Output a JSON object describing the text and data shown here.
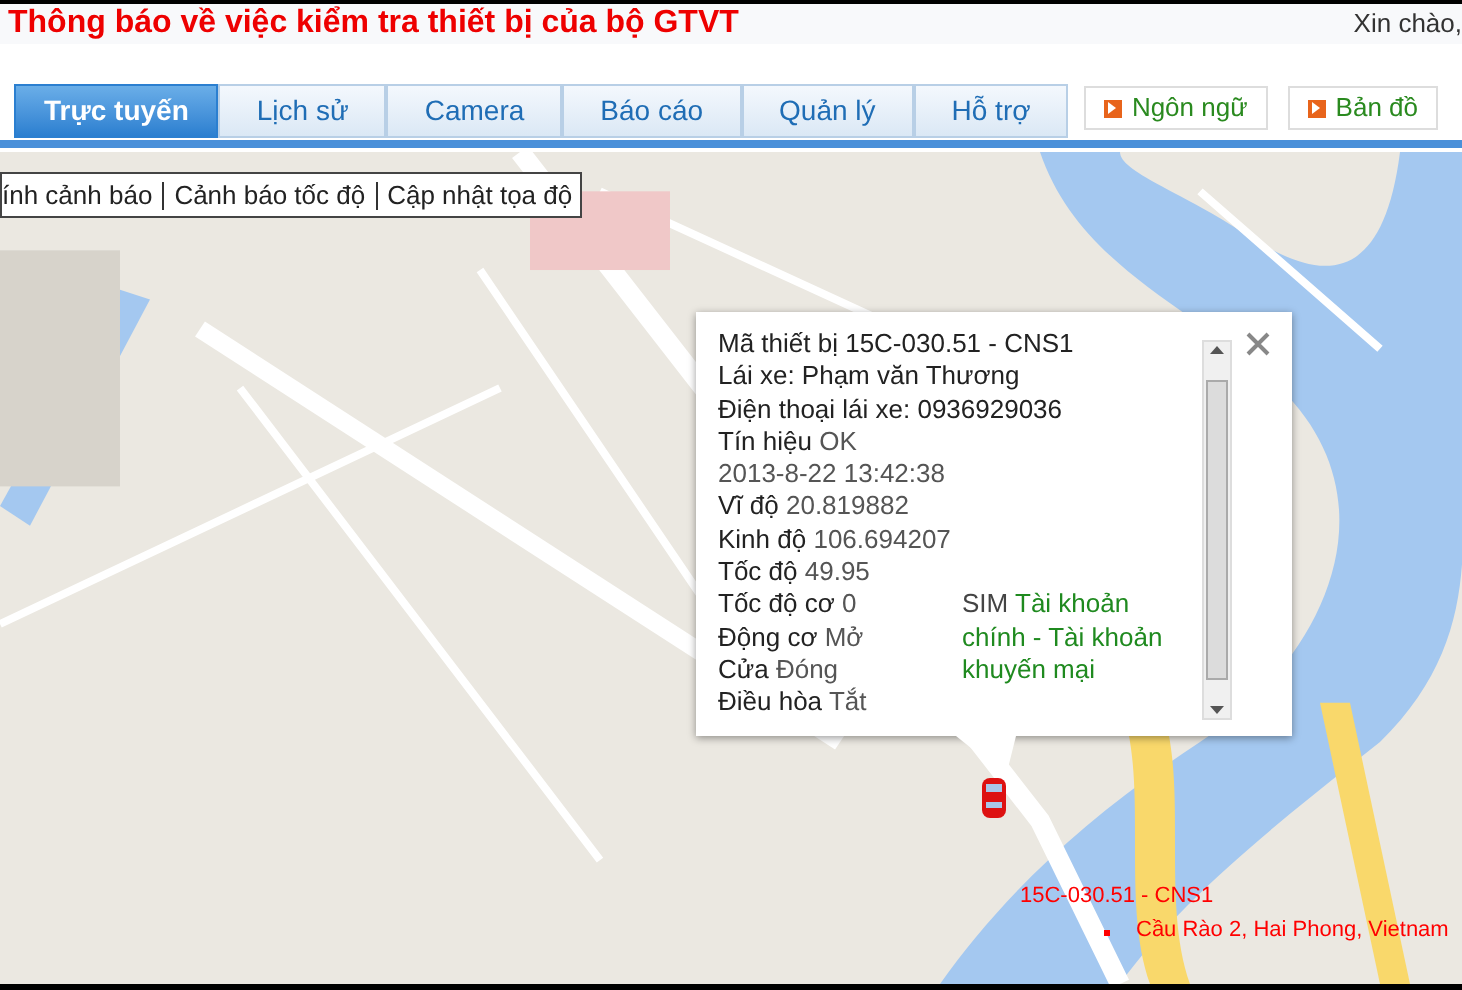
{
  "header": {
    "title": "Thông báo về việc kiểm tra thiết bị của bộ GTVT",
    "greeting": "Xin chào,"
  },
  "tabs": [
    {
      "label": "Trực tuyến",
      "selected": true
    },
    {
      "label": "Lịch sử",
      "selected": false
    },
    {
      "label": "Camera",
      "selected": false
    },
    {
      "label": "Báo cáo",
      "selected": false
    },
    {
      "label": "Quản lý",
      "selected": false
    },
    {
      "label": "Hỗ trợ",
      "selected": false
    }
  ],
  "header_buttons": [
    "Ngôn ngữ",
    "Bản đồ"
  ],
  "map_toolbar": [
    "ính cảnh báo",
    "Cảnh báo tốc độ",
    "Cập nhật tọa độ"
  ],
  "popup": {
    "lines": [
      {
        "label": "Mã thiết bị 15C-030.51 - CNS1"
      },
      {
        "label": "Lái xe: Phạm văn Thương"
      },
      {
        "label": "Điện thoại lái xe: 0936929036"
      },
      {
        "label": "Tín hiệu",
        "value": "OK"
      },
      {
        "value": "2013-8-22 13:42:38"
      },
      {
        "label": "Vĩ độ",
        "value": "20.819882"
      },
      {
        "label": "Kinh độ",
        "value": "106.694207"
      },
      {
        "label": "Tốc độ",
        "value": "49.95"
      },
      {
        "label": "Tốc độ cơ",
        "value": "0"
      },
      {
        "label": "Động cơ",
        "value": "Mở"
      },
      {
        "label": "Cửa",
        "value": "Đóng"
      },
      {
        "label": "Điều hòa",
        "value": "Tắt"
      }
    ],
    "sim": {
      "label": "SIM",
      "value": "Tài khoản chính - Tài khoản khuyến mại"
    }
  },
  "marker": {
    "name": "15C-030.51 - CNS1",
    "address": "Cầu Rào 2, Hai Phong, Vietnam"
  }
}
